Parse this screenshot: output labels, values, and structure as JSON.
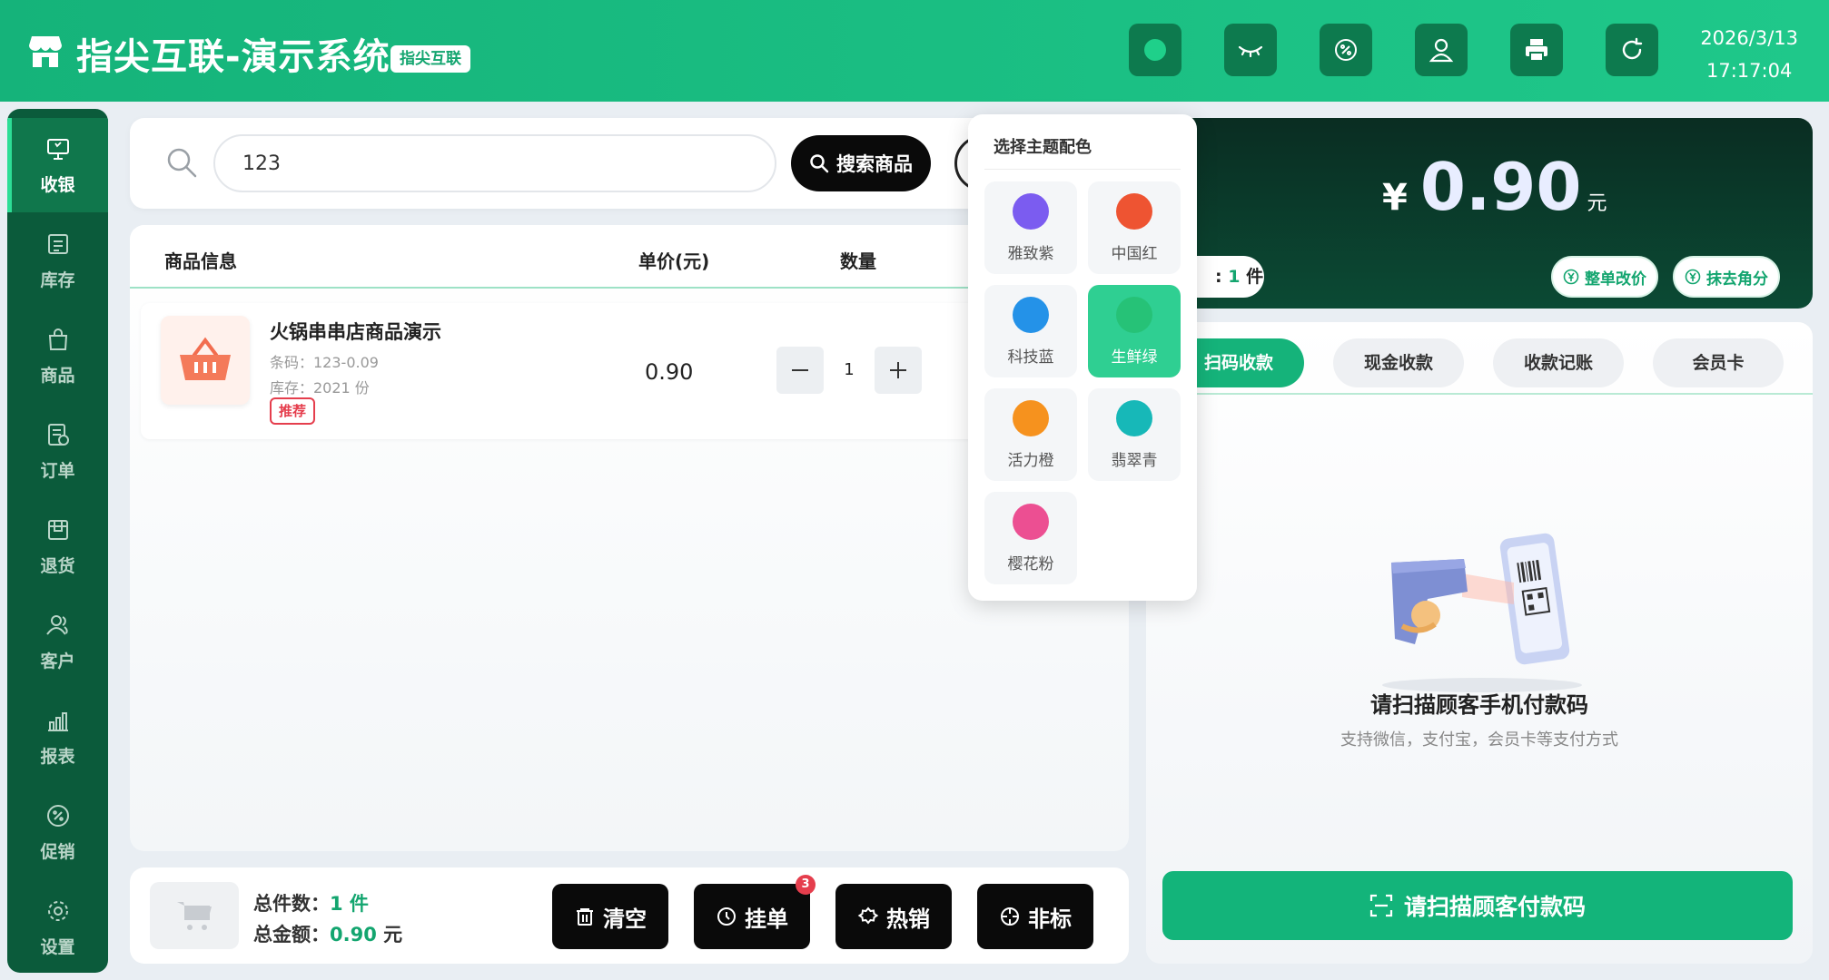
{
  "header": {
    "title": "指尖互联-演示系统",
    "badge": "指尖互联",
    "date": "2026/3/13",
    "time": "17:17:04",
    "buttons": [
      "theme-dot-icon",
      "eye-closed-icon",
      "discount-icon",
      "user-icon",
      "printer-icon",
      "refresh-icon"
    ]
  },
  "sidebar": {
    "items": [
      {
        "label": "收银",
        "icon": "monitor-icon"
      },
      {
        "label": "库存",
        "icon": "inventory-icon"
      },
      {
        "label": "商品",
        "icon": "bag-icon"
      },
      {
        "label": "订单",
        "icon": "order-icon"
      },
      {
        "label": "退货",
        "icon": "return-icon"
      },
      {
        "label": "客户",
        "icon": "customer-icon"
      },
      {
        "label": "报表",
        "icon": "chart-icon"
      },
      {
        "label": "促销",
        "icon": "promo-icon"
      },
      {
        "label": "设置",
        "icon": "gear-icon"
      }
    ],
    "active": "收银"
  },
  "search": {
    "value": "123",
    "button": "搜索商品"
  },
  "table": {
    "headers": [
      "商品信息",
      "单价(元)",
      "数量"
    ],
    "rows": [
      {
        "name": "火锅串串店商品演示",
        "barcode": "条码：123-0.09",
        "stock": "库存：2021 份",
        "tag": "推荐",
        "price": "0.90",
        "qty": "1"
      }
    ]
  },
  "footer": {
    "total_count_label": "总件数：",
    "total_count_value": "1 件",
    "total_amount_label": "总金额：",
    "total_amount_value": "0.90",
    "total_amount_unit": "元",
    "buttons": {
      "clear": "清空",
      "hold": "挂单",
      "hold_badge": "3",
      "hot": "热销",
      "nonstd": "非标"
    }
  },
  "total": {
    "currency": "¥",
    "amount": "0.90",
    "unit": "元",
    "count_prefix": ":",
    "count_value": "1",
    "count_unit": "件",
    "change_price": "整单改价",
    "round_off": "抹去角分"
  },
  "payment": {
    "tabs": [
      "扫码收款",
      "现金收款",
      "收款记账",
      "会员卡"
    ],
    "active_tab": "扫码收款",
    "title": "请扫描顾客手机付款码",
    "subtitle": "支持微信，支付宝，会员卡等支付方式",
    "scan_button": "请扫描顾客付款码"
  },
  "theme_popover": {
    "title": "选择主题配色",
    "active": "生鲜绿",
    "options": [
      {
        "label": "雅致紫",
        "color": "#7b5cf0"
      },
      {
        "label": "中国红",
        "color": "#ee5432"
      },
      {
        "label": "科技蓝",
        "color": "#2492e8"
      },
      {
        "label": "生鲜绿",
        "color": "#26c277"
      },
      {
        "label": "活力橙",
        "color": "#f6921e"
      },
      {
        "label": "翡翠青",
        "color": "#17b8b8"
      },
      {
        "label": "樱花粉",
        "color": "#ec4f92"
      }
    ]
  },
  "colors": {
    "brand": "#15b37a",
    "sidebar": "#0b5b3b",
    "total_bg": "#0b3a2a",
    "danger": "#e53e4d"
  }
}
